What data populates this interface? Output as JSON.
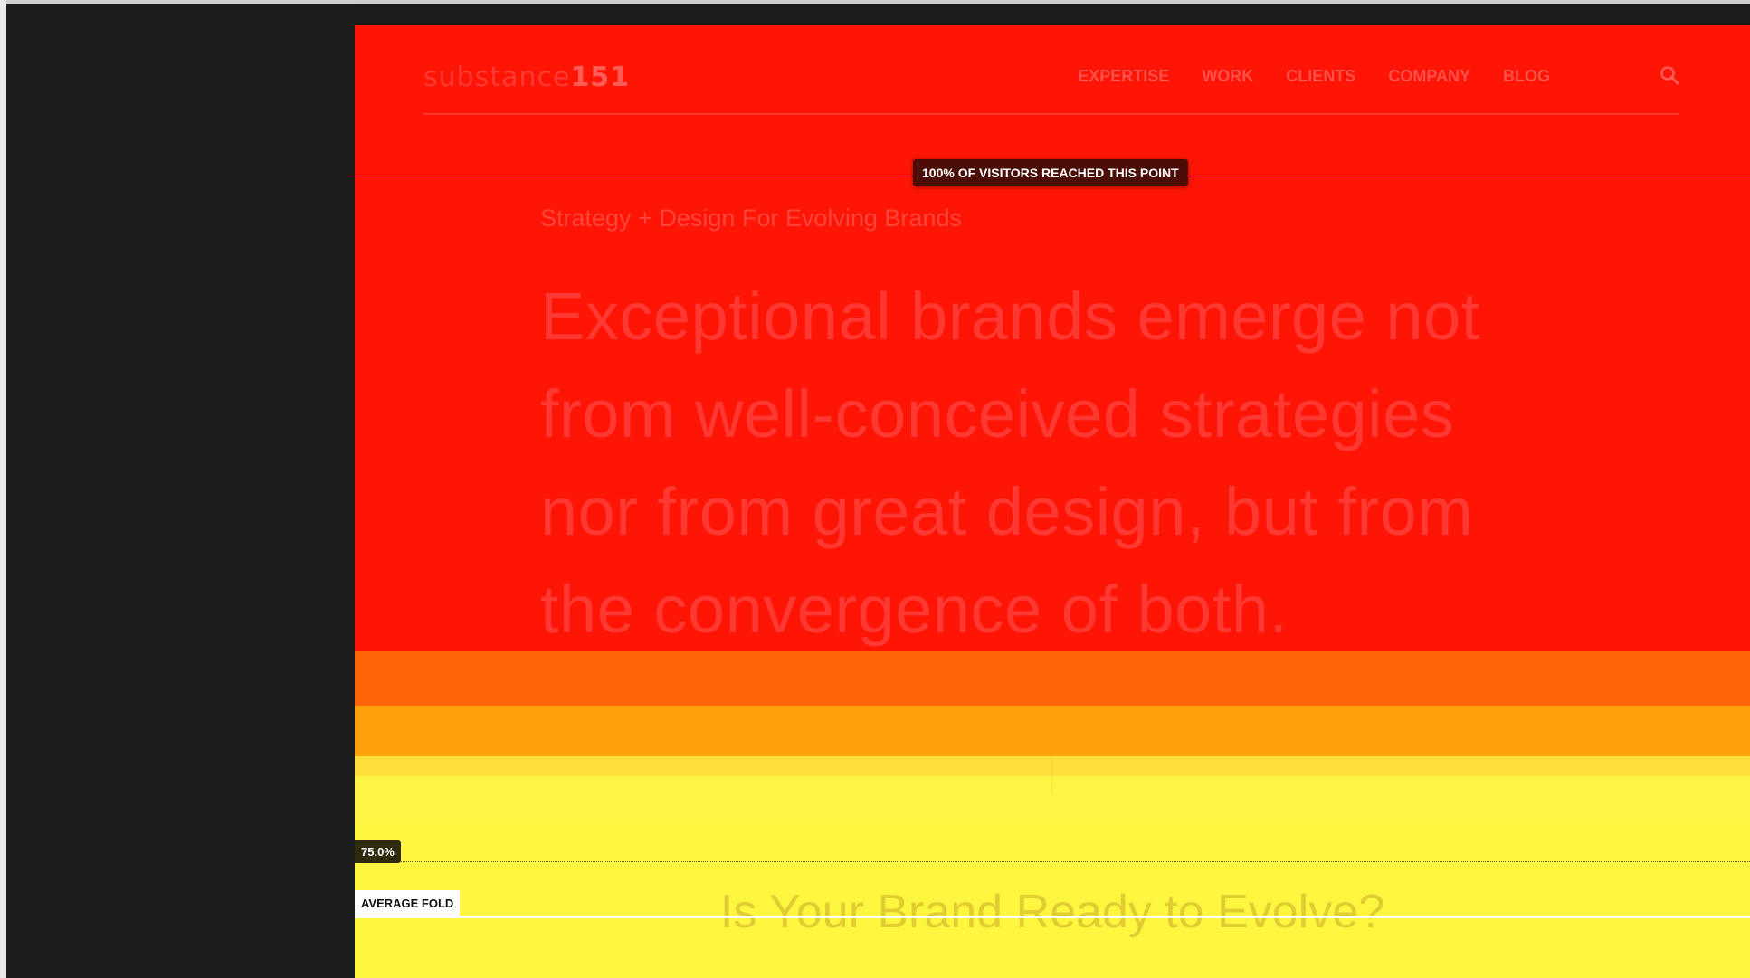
{
  "site": {
    "logo": {
      "text": "substance",
      "number": "151"
    },
    "nav": [
      "EXPERTISE",
      "WORK",
      "CLIENTS",
      "COMPANY",
      "BLOG"
    ],
    "tagline": "Strategy + Design For Evolving Brands",
    "hero": "Exceptional brands emerge not from well-conceived strategies nor from great design, but from the convergence of both.",
    "cta_heading": "Is Your Brand Ready to Evolve?"
  },
  "heatmap": {
    "top_marker": "100% OF VISITORS REACHED THIS POINT",
    "scroll_marker": "75.0%",
    "fold_label": "AVERAGE FOLD",
    "colors": [
      "#fe1505",
      "#ff6508",
      "#ffa10a",
      "#ffdf3c",
      "#fff444",
      "#fff73f"
    ]
  },
  "icons": {
    "search": "search-icon"
  }
}
